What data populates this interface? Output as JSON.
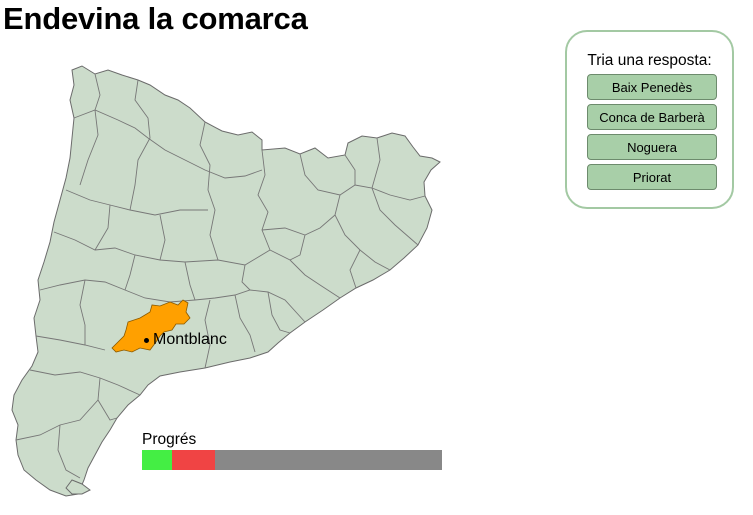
{
  "title": "Endevina la comarca",
  "map": {
    "region_fill": "#ccdccb",
    "border_color": "#777777",
    "highlight_fill": "#ffa000",
    "highlight_label": "Montblanc"
  },
  "quiz": {
    "prompt": "Tria una resposta:",
    "options": [
      "Baix Penedès",
      "Conca de Barberà",
      "Noguera",
      "Priorat"
    ],
    "button_color": "#a8cfa8",
    "panel_border": "#a3c9a3"
  },
  "progress": {
    "label": "Progrés",
    "correct_fraction": 0.1,
    "wrong_fraction": 0.143,
    "colors": {
      "correct": "#44ee44",
      "wrong": "#f04444",
      "remaining": "#888888"
    }
  }
}
